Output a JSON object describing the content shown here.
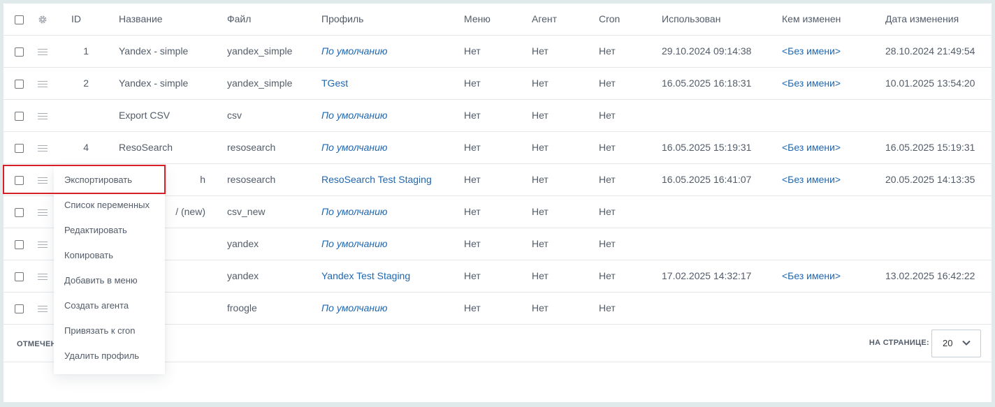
{
  "columns": [
    "ID",
    "Название",
    "Файл",
    "Профиль",
    "Меню",
    "Агент",
    "Cron",
    "Использован",
    "Кем изменен",
    "Дата изменения"
  ],
  "rows": [
    {
      "id": "1",
      "name": "Yandex - simple",
      "file": "yandex_simple",
      "profile": "По умолчанию",
      "profile_default": true,
      "menu": "Нет",
      "agent": "Нет",
      "cron": "Нет",
      "used": "29.10.2024 09:14:38",
      "changed_by": "<Без имени>",
      "changed_at": "28.10.2024 21:49:54"
    },
    {
      "id": "2",
      "name": "Yandex - simple",
      "file": "yandex_simple",
      "profile": "TGest",
      "profile_default": false,
      "menu": "Нет",
      "agent": "Нет",
      "cron": "Нет",
      "used": "16.05.2025 16:18:31",
      "changed_by": "<Без имени>",
      "changed_at": "10.01.2025 13:54:20"
    },
    {
      "id": "",
      "name": "Export CSV",
      "file": "csv",
      "profile": "По умолчанию",
      "profile_default": true,
      "menu": "Нет",
      "agent": "Нет",
      "cron": "Нет",
      "used": "",
      "changed_by": "",
      "changed_at": ""
    },
    {
      "id": "4",
      "name": "ResoSearch",
      "file": "resosearch",
      "profile": "По умолчанию",
      "profile_default": true,
      "menu": "Нет",
      "agent": "Нет",
      "cron": "Нет",
      "used": "16.05.2025 15:19:31",
      "changed_by": "<Без имени>",
      "changed_at": "16.05.2025 15:19:31"
    },
    {
      "id": "",
      "name": "h",
      "file": "resosearch",
      "profile": "ResoSearch Test Staging",
      "profile_default": false,
      "menu": "Нет",
      "agent": "Нет",
      "cron": "Нет",
      "used": "16.05.2025 16:41:07",
      "changed_by": "<Без имени>",
      "changed_at": "20.05.2025 14:13:35"
    },
    {
      "id": "",
      "name": "/ (new)",
      "file": "csv_new",
      "profile": "По умолчанию",
      "profile_default": true,
      "menu": "Нет",
      "agent": "Нет",
      "cron": "Нет",
      "used": "",
      "changed_by": "",
      "changed_at": ""
    },
    {
      "id": "",
      "name": "",
      "file": "yandex",
      "profile": "По умолчанию",
      "profile_default": true,
      "menu": "Нет",
      "agent": "Нет",
      "cron": "Нет",
      "used": "",
      "changed_by": "",
      "changed_at": ""
    },
    {
      "id": "",
      "name": "",
      "file": "yandex",
      "profile": "Yandex Test Staging",
      "profile_default": false,
      "menu": "Нет",
      "agent": "Нет",
      "cron": "Нет",
      "used": "17.02.2025 14:32:17",
      "changed_by": "<Без имени>",
      "changed_at": "13.02.2025 16:42:22"
    },
    {
      "id": "",
      "name": "",
      "file": "froogle",
      "profile": "По умолчанию",
      "profile_default": true,
      "menu": "Нет",
      "agent": "Нет",
      "cron": "Нет",
      "used": "",
      "changed_by": "",
      "changed_at": ""
    }
  ],
  "footer": {
    "selected_label": "ОТМЕЧЕН",
    "per_page_label": "НА СТРАНИЦЕ:",
    "per_page_value": "20"
  },
  "context_menu": {
    "items": [
      "Экспортировать",
      "Список переменных",
      "Редактировать",
      "Копировать",
      "Добавить в меню",
      "Создать агента",
      "Привязать к cron",
      "Удалить профиль"
    ]
  },
  "colors": {
    "link": "#2067b0",
    "highlight": "#d61f26",
    "background": "#e1eaeb"
  }
}
